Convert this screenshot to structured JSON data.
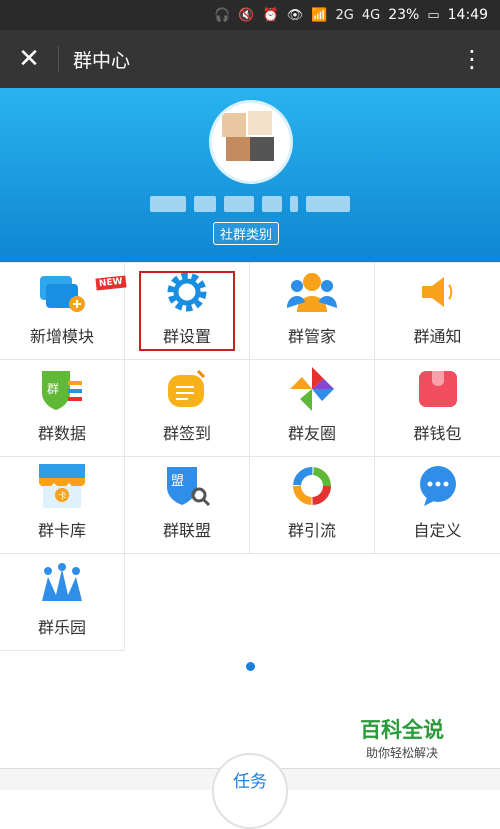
{
  "statusbar": {
    "battery": "23%",
    "time": "14:49",
    "net1": "2G",
    "net2": "4G"
  },
  "titlebar": {
    "title": "群中心",
    "close_icon": "close-icon",
    "more_icon": "more-vertical-icon"
  },
  "banner": {
    "category_tag": "社群类别"
  },
  "grid": {
    "items": [
      {
        "label": "新增模块",
        "icon": "add-module-icon",
        "badge": "NEW"
      },
      {
        "label": "群设置",
        "icon": "gear-icon"
      },
      {
        "label": "群管家",
        "icon": "users-manager-icon"
      },
      {
        "label": "群通知",
        "icon": "speaker-icon"
      },
      {
        "label": "群数据",
        "icon": "data-chart-icon"
      },
      {
        "label": "群签到",
        "icon": "checkin-icon"
      },
      {
        "label": "群友圈",
        "icon": "pinwheel-icon"
      },
      {
        "label": "群钱包",
        "icon": "wallet-icon"
      },
      {
        "label": "群卡库",
        "icon": "card-store-icon"
      },
      {
        "label": "群联盟",
        "icon": "alliance-icon"
      },
      {
        "label": "群引流",
        "icon": "traffic-icon"
      },
      {
        "label": "自定义",
        "icon": "chat-bubble-icon"
      },
      {
        "label": "群乐园",
        "icon": "crown-icon"
      }
    ]
  },
  "watermark": {
    "title": "百科全说",
    "subtitle": "助你轻松解决"
  },
  "bottom": {
    "task_label": "任务"
  },
  "colors": {
    "accent": "#1a7fd8",
    "banner_top": "#29b3ef",
    "highlight": "#c91f1f"
  }
}
